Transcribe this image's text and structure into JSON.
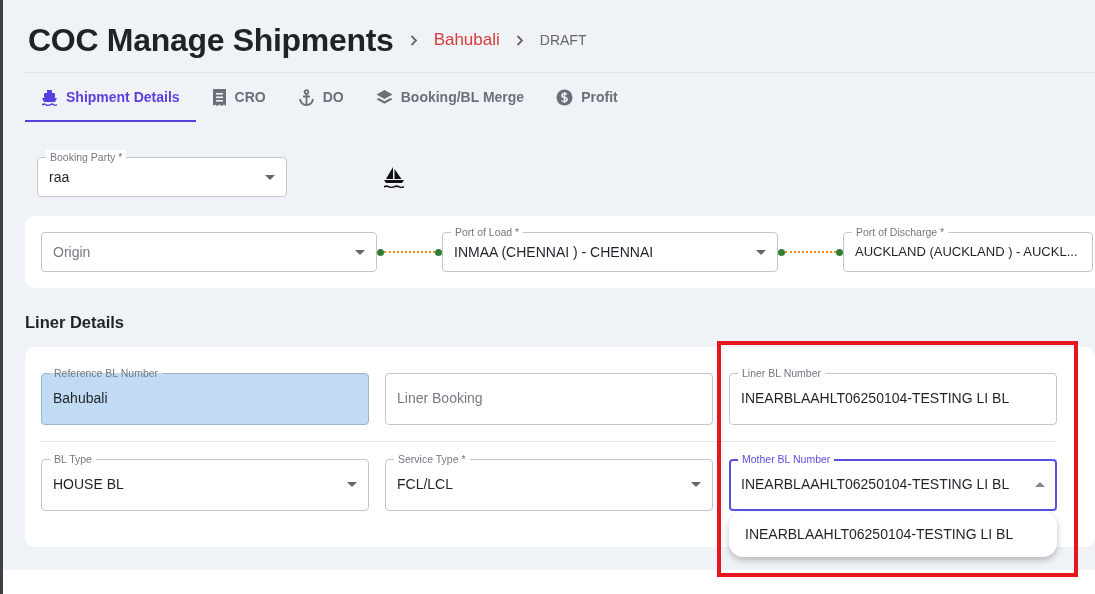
{
  "header": {
    "title": "COC Manage Shipments",
    "breadcrumbs": [
      {
        "label": "Bahubali",
        "kind": "link"
      },
      {
        "label": "DRAFT",
        "kind": "status"
      }
    ]
  },
  "tabs": [
    {
      "label": "Shipment Details",
      "selected": true
    },
    {
      "label": "CRO",
      "selected": false
    },
    {
      "label": "DO",
      "selected": false
    },
    {
      "label": "Booking/BL Merge",
      "selected": false
    },
    {
      "label": "Profit",
      "selected": false
    }
  ],
  "booking_party": {
    "label": "Booking Party *",
    "value": "raa",
    "kind": "select"
  },
  "route": [
    {
      "placeholder": "Origin",
      "kind": "select"
    },
    {
      "label": "Port of Load *",
      "value": "INMAA (CHENNAI ) - CHENNAI",
      "kind": "select"
    },
    {
      "label": "Port of Discharge *",
      "value": "AUCKLAND (AUCKLAND ) - AUCKL...",
      "kind": "text"
    }
  ],
  "liner_details": {
    "title": "Liner Details",
    "rows": [
      [
        {
          "label": "Reference BL Number",
          "value": "Bahubali",
          "kind": "text",
          "highlighted": true
        },
        {
          "placeholder": "Liner Booking",
          "kind": "text",
          "highlighted": false
        },
        {
          "label": "Liner BL Number",
          "value": "INEARBLAAHLT06250104-TESTING LI BL",
          "kind": "text",
          "highlighted": false
        }
      ],
      [
        {
          "label": "BL Type",
          "value": "HOUSE BL",
          "kind": "select",
          "highlighted": false
        },
        {
          "label": "Service Type *",
          "value": "FCL/LCL",
          "kind": "select",
          "highlighted": false
        },
        {
          "label": "Mother BL Number",
          "value": "INEARBLAAHLT06250104-TESTING LI BL",
          "kind": "select",
          "highlighted": false,
          "expanded": true,
          "options": [
            "INEARBLAAHLT06250104-TESTING LI BL"
          ]
        }
      ]
    ]
  }
}
